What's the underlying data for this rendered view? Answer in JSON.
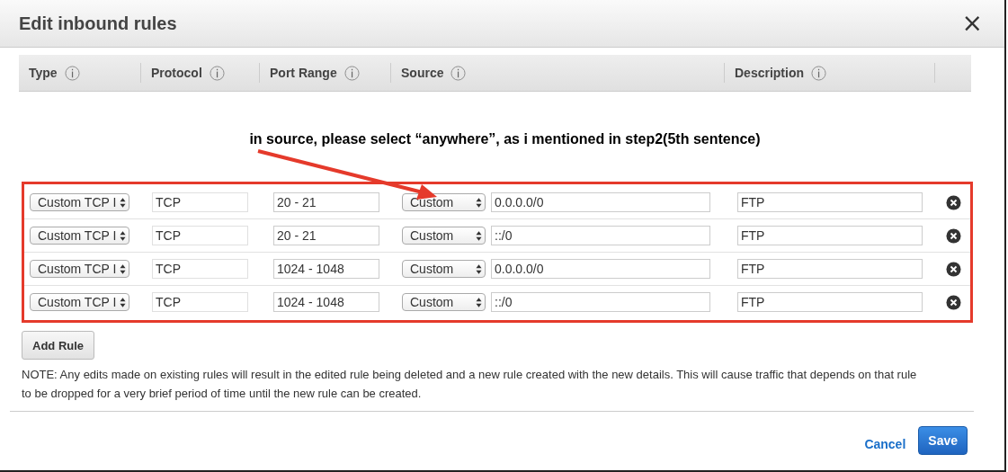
{
  "dialog": {
    "title": "Edit inbound rules",
    "close": "×"
  },
  "columns": [
    {
      "label": "Type"
    },
    {
      "label": "Protocol"
    },
    {
      "label": "Port Range"
    },
    {
      "label": "Source"
    },
    {
      "label": "Description"
    }
  ],
  "annotation": {
    "text": "in source, please select “anywhere”, as i mentioned in step2(5th sentence)"
  },
  "rules": [
    {
      "type": "Custom TCP I",
      "protocol": "TCP",
      "port_range": "20 - 21",
      "source": "Custom",
      "cidr": "0.0.0.0/0",
      "description": "FTP"
    },
    {
      "type": "Custom TCP I",
      "protocol": "TCP",
      "port_range": "20 - 21",
      "source": "Custom",
      "cidr": "::/0",
      "description": "FTP"
    },
    {
      "type": "Custom TCP I",
      "protocol": "TCP",
      "port_range": "1024 - 1048",
      "source": "Custom",
      "cidr": "0.0.0.0/0",
      "description": "FTP"
    },
    {
      "type": "Custom TCP I",
      "protocol": "TCP",
      "port_range": "1024 - 1048",
      "source": "Custom",
      "cidr": "::/0",
      "description": "FTP"
    }
  ],
  "add_button": "Add Rule",
  "note": "NOTE: Any edits made on existing rules will result in the edited rule being deleted and a new rule created with the new details. This will cause traffic that depends on that rule to be dropped for a very brief period of time until the new rule can be created.",
  "footer": {
    "cancel": "Cancel",
    "save": "Save"
  }
}
